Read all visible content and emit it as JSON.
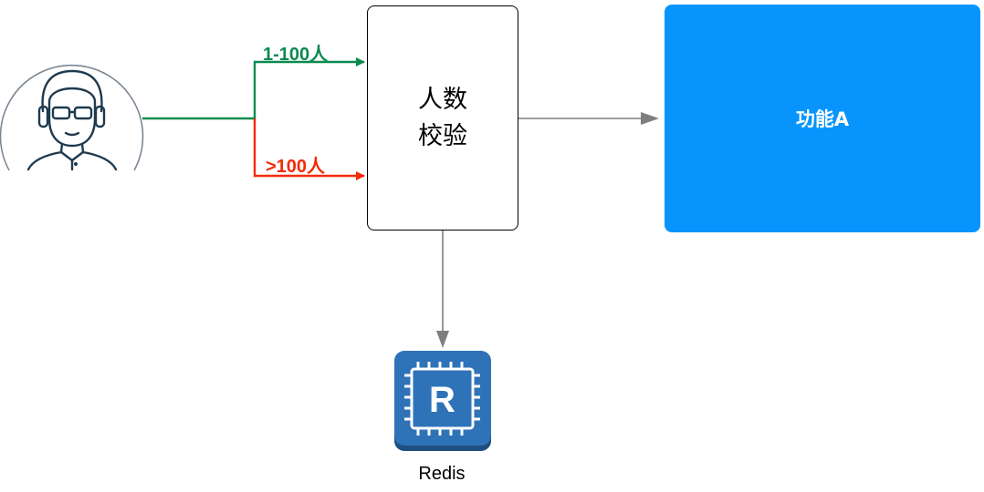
{
  "nodes": {
    "validate": {
      "line1": "人数",
      "line2": "校验"
    },
    "feature": {
      "label": "功能A"
    },
    "redis": {
      "caption": "Redis",
      "letter": "R"
    }
  },
  "edges": {
    "small_group": {
      "label": "1-100人"
    },
    "large_group": {
      "label": ">100人"
    }
  },
  "colors": {
    "green_path": "#0b8a4f",
    "red_path": "#f22b06",
    "gray_arrow": "#7f7f7f",
    "feature_fill": "#0795fd",
    "redis_fill": "#2e73b8",
    "user_outline": "#1e3a4f",
    "circle_outline": "#7a8794"
  },
  "icons": {
    "user": "user-avatar-icon",
    "redis": "redis-icon"
  }
}
